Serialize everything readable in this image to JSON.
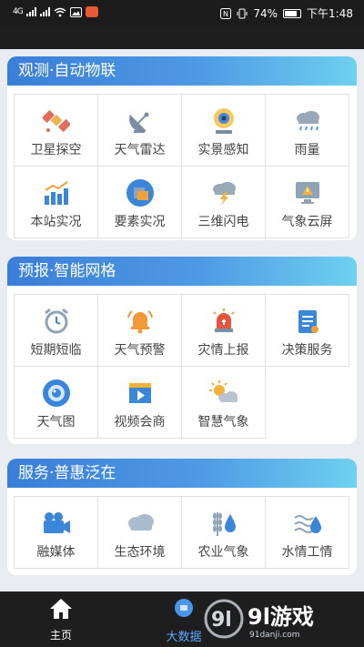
{
  "statusbar": {
    "left_signal": "4G",
    "battery": "74%",
    "time": "下午1:48"
  },
  "sections": [
    {
      "title": "观测·自动物联",
      "items": [
        {
          "label": "卫星探空",
          "icon": "satellite-icon"
        },
        {
          "label": "天气雷达",
          "icon": "radar-icon"
        },
        {
          "label": "实景感知",
          "icon": "webcam-icon"
        },
        {
          "label": "雨量",
          "icon": "rain-cloud-icon"
        },
        {
          "label": "本站实况",
          "icon": "bar-chart-icon"
        },
        {
          "label": "要素实况",
          "icon": "element-icon"
        },
        {
          "label": "三维闪电",
          "icon": "lightning-icon"
        },
        {
          "label": "气象云屏",
          "icon": "monitor-icon"
        }
      ]
    },
    {
      "title": "预报·智能网格",
      "items": [
        {
          "label": "短期短临",
          "icon": "alarm-clock-icon"
        },
        {
          "label": "天气预警",
          "icon": "bell-icon"
        },
        {
          "label": "灾情上报",
          "icon": "siren-icon"
        },
        {
          "label": "决策服务",
          "icon": "clipboard-icon"
        },
        {
          "label": "天气图",
          "icon": "eye-icon"
        },
        {
          "label": "视频会商",
          "icon": "video-icon"
        },
        {
          "label": "智慧气象",
          "icon": "sun-cloud-icon"
        }
      ]
    },
    {
      "title": "服务·普惠泛在",
      "items": [
        {
          "label": "融媒体",
          "icon": "camera-icon"
        },
        {
          "label": "生态环境",
          "icon": "cloud-icon"
        },
        {
          "label": "农业气象",
          "icon": "wheat-drop-icon"
        },
        {
          "label": "水情工情",
          "icon": "water-icon"
        }
      ]
    }
  ],
  "bottom_nav": {
    "home_label": "主页",
    "data_label": "大数据"
  },
  "watermark": {
    "brand": "9l游戏",
    "url": "91danji.com"
  }
}
